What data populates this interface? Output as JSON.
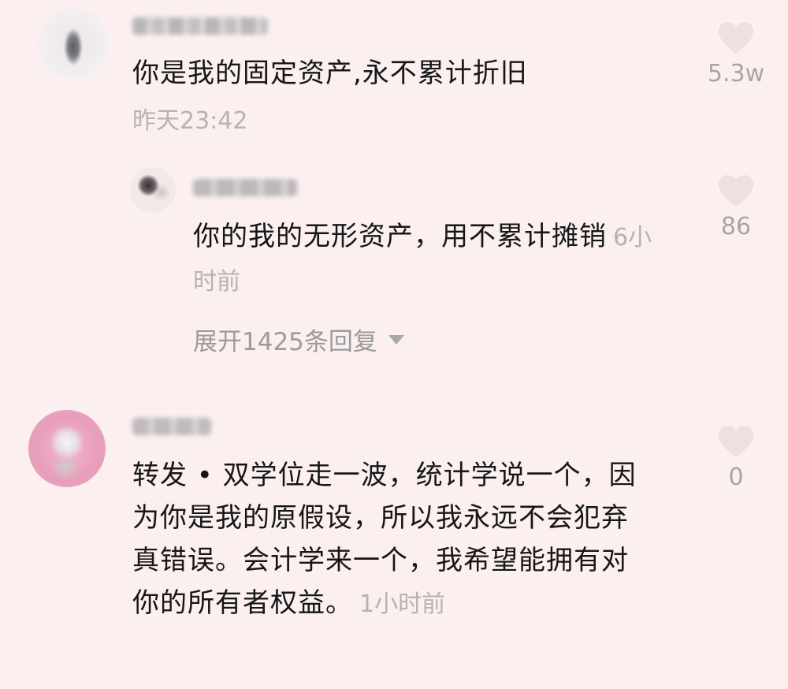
{
  "comments": [
    {
      "text": "你是我的固定资产,永不累计折旧",
      "time": "昨天23:42",
      "likes": "5.3w"
    },
    {
      "reply": true,
      "text": "你的我的无形资产，用不累计摊销",
      "time": "6小时前",
      "likes": "86"
    },
    {
      "text": "转发 • 双学位走一波，统计学说一个，因为你是我的原假设，所以我永远不会犯弃真错误。会计学来一个，我希望能拥有对你的所有者权益。",
      "time": "1小时前",
      "likes": "0"
    }
  ],
  "expand_replies_label": "展开1425条回复",
  "icons": {
    "heart": "heart-icon",
    "caret": "chevron-down-icon"
  },
  "colors": {
    "background": "#fbefef",
    "text": "#161616",
    "muted": "#b5b3b4",
    "heart": "#ece1de"
  }
}
